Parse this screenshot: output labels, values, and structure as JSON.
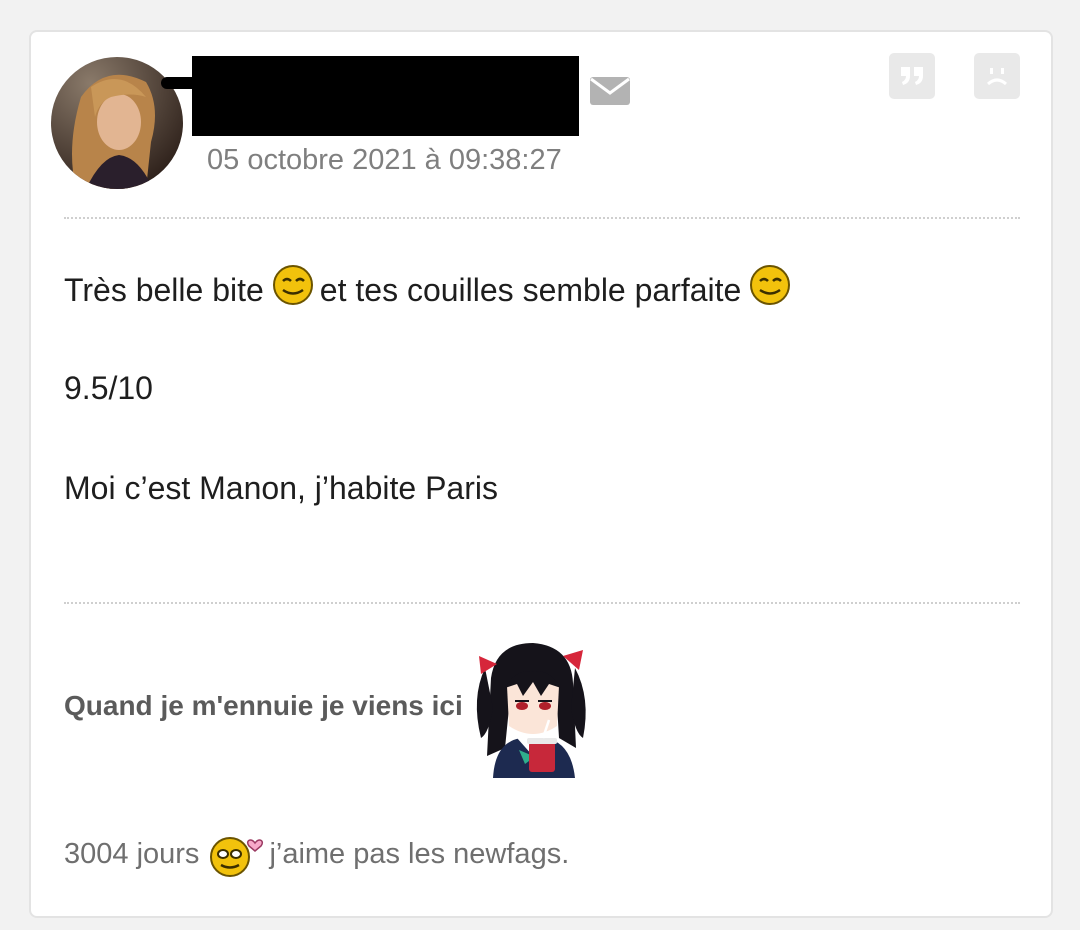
{
  "post": {
    "date": "05 octobre 2021 à 09:38:27",
    "message": {
      "line1_part1": "Très belle bite",
      "line1_part2": "et tes couilles semble parfaite",
      "line2": "9.5/10",
      "line3": "Moi c’est Manon, j’habite Paris"
    },
    "icons": {
      "mail": "envelope-icon",
      "quote": "quote-icon",
      "report": "sad-face-icon",
      "smiley": "wink-smiley-icon",
      "love": "love-smiley-icon"
    }
  },
  "signature": {
    "line1": "Quand je m'ennuie je viens ici",
    "days": "3004 jours",
    "line2_text": "j’aime pas les newfags."
  },
  "colors": {
    "background": "#f2f2f2",
    "card": "#ffffff",
    "date_text": "#7f7f7f",
    "body_text": "#1e1e1e",
    "smiley_yellow": "#f2c20c"
  }
}
